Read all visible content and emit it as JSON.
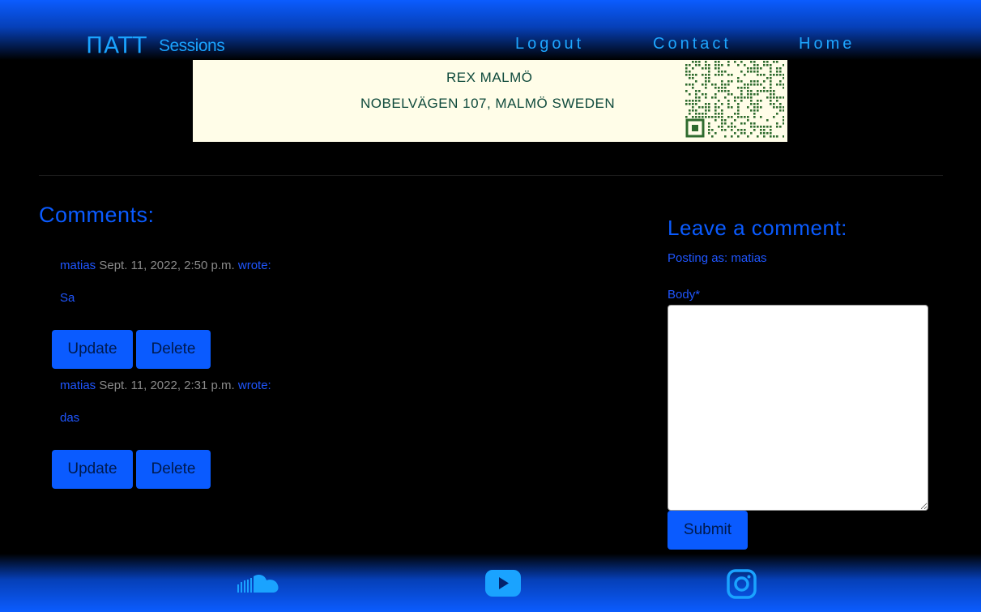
{
  "navbar": {
    "logo": "ΠATT",
    "subtitle": "Sessions",
    "links": [
      "Logout",
      "Contact",
      "Home"
    ]
  },
  "banner": {
    "line1": "REX MALMÖ",
    "line2": "NOBELVÄGEN 107, MALMÖ SWEDEN"
  },
  "comments": {
    "title": "Comments:",
    "items": [
      {
        "author": "matias",
        "date": "Sept. 11, 2022, 2:50 p.m.",
        "wrote": "wrote:",
        "body": "Sa",
        "update_label": "Update",
        "delete_label": "Delete"
      },
      {
        "author": "matias",
        "date": "Sept. 11, 2022, 2:31 p.m.",
        "wrote": "wrote:",
        "body": "das",
        "update_label": "Update",
        "delete_label": "Delete"
      }
    ]
  },
  "comment_form": {
    "title": "Leave a comment:",
    "posting_as": "Posting as: matias",
    "body_label": "Body*",
    "body_value": "",
    "submit_label": "Submit"
  },
  "footer": {
    "icons": [
      "soundcloud-icon",
      "youtube-icon",
      "instagram-icon"
    ]
  },
  "colors": {
    "accent": "#0a5bff",
    "nav_text": "#1ea6ff",
    "banner_bg": "#fffde8",
    "banner_text": "#0f4a3c",
    "date_text": "#8a8a8a"
  }
}
